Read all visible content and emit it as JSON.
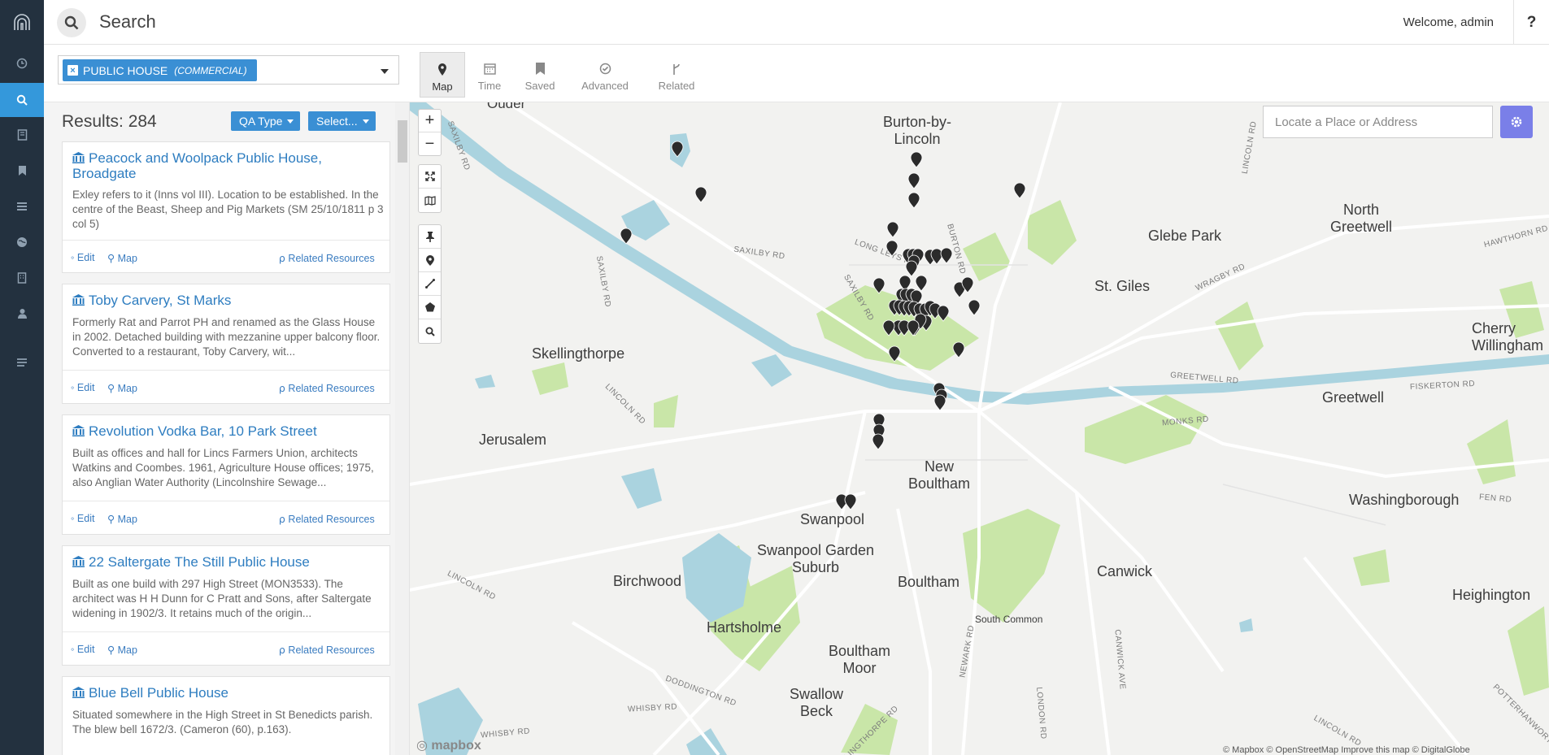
{
  "topbar": {
    "search_label": "Search",
    "welcome": "Welcome, admin",
    "help": "?"
  },
  "sidebar": {
    "icons": [
      "logo-icon",
      "clock-icon",
      "search-icon",
      "book-icon",
      "bookmark-icon",
      "list-icon",
      "globe-icon",
      "building-icon",
      "user-icon",
      "menu-icon"
    ]
  },
  "filter": {
    "tag_label": "PUBLIC HOUSE",
    "tag_sub": "(COMMERCIAL)",
    "tag_remove": "×"
  },
  "tabs": [
    {
      "label": "Map"
    },
    {
      "label": "Time"
    },
    {
      "label": "Saved"
    },
    {
      "label": "Advanced"
    },
    {
      "label": "Related"
    }
  ],
  "results": {
    "count_label": "Results: 284",
    "qa_button": "QA Type",
    "select_button": "Select...",
    "edit_label": "Edit",
    "map_label": "Map",
    "related_label": "Related Resources",
    "items": [
      {
        "title": "Peacock and Woolpack Public House, Broadgate",
        "description": "Exley refers to it (Inns vol III). Location to be established. In the centre of the Beast, Sheep and Pig Markets (SM 25/10/1811 p 3 col 5)"
      },
      {
        "title": "Toby Carvery, St Marks",
        "description": "Formerly Rat and Parrot PH and renamed as the Glass House in 2002. Detached building with mezzanine upper balcony floor. Converted to a restaurant, Toby Carvery, wit..."
      },
      {
        "title": "Revolution Vodka Bar, 10 Park Street",
        "description": "Built as offices and hall for Lincs Farmers Union, architects Watkins and Coombes. 1961, Agriculture House offices; 1975, also Anglian Water Authority (Lincolnshire Sewage..."
      },
      {
        "title": "22 Saltergate The Still Public House",
        "description": "Built as one build with 297 High Street (MON3533). The architect was H H Dunn for C Pratt and Sons, after Saltergate widening in 1902/3. It retains much of the origin..."
      },
      {
        "title": "Blue Bell Public House",
        "description": "Situated somewhere in the High Street in St Benedicts parish. The blew bell 1672/3. (Cameron (60), p.163)."
      }
    ]
  },
  "map": {
    "locate_placeholder": "Locate a Place or Address",
    "zoom_in": "+",
    "zoom_out": "−",
    "logo": "mapbox",
    "attribution": "© Mapbox © OpenStreetMap Improve this map © DigitalGlobe",
    "places": [
      "Ouder",
      "Burton-by-Lincoln",
      "North Greetwell",
      "Glebe Park",
      "St. Giles",
      "Cherry Willingham",
      "Skellingthorpe",
      "Greetwell",
      "Jerusalem",
      "New Boultham",
      "Washingborough",
      "Swanpool",
      "Swanpool Garden Suburb",
      "Birchwood",
      "Boultham",
      "Canwick",
      "Heighington",
      "Hartsholme",
      "South Common",
      "Boultham Moor",
      "Swallow Beck"
    ],
    "roads": [
      "SAXILBY RD",
      "SAXILBY RD",
      "LONG LEYS RD",
      "BURTON RD",
      "LINCOLN RD",
      "SAXILBY RD",
      "SAXILBY RD",
      "WRAGBY RD",
      "GREETWELL RD",
      "HAWTHORN RD",
      "FISKERTON RD",
      "LINCOLN RD",
      "MONKS RD",
      "FEN RD",
      "LINCOLN RD",
      "NEWARK RD",
      "CANWICK AVE",
      "DODDINGTON RD",
      "WHISBY RD",
      "WHISBY RD",
      "LONDON RD",
      "LINCOLN RD",
      "POTTERHANWORTH",
      "SKELLINGTHORPE RD"
    ]
  },
  "colors": {
    "sidebar": "#23313f",
    "active": "#3498db",
    "accent": "#3a8fd4",
    "water": "#aad3df",
    "park": "#c9e6a8"
  }
}
